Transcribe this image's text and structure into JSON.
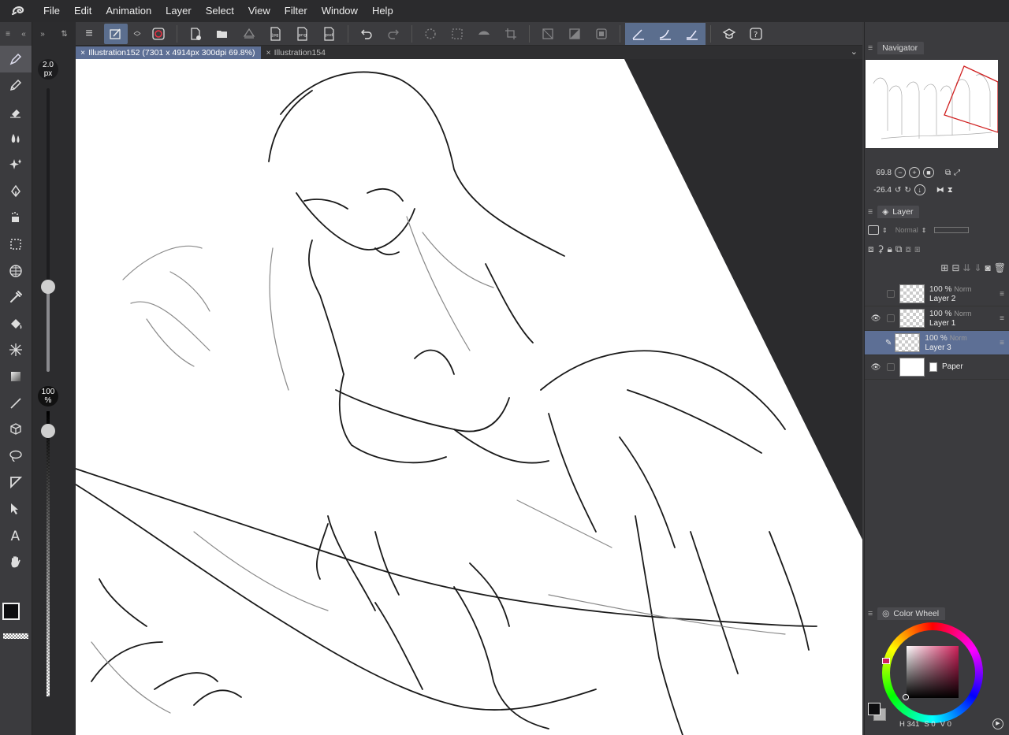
{
  "menu": {
    "items": [
      "File",
      "Edit",
      "Animation",
      "Layer",
      "Select",
      "View",
      "Filter",
      "Window",
      "Help"
    ]
  },
  "tabs": [
    {
      "label": "Illustration152 (7301 x 4914px 300dpi 69.8%)",
      "active": true
    },
    {
      "label": "Illustration154",
      "active": false
    }
  ],
  "toolbar": {
    "icons": [
      "menu-icon",
      "quick-access-icon",
      "toggle-icon",
      "record-icon",
      "new-canvas-icon",
      "open-icon",
      "save-icon",
      "export-jpg-icon",
      "export-png-icon",
      "export-psd-icon",
      "undo-icon",
      "redo-icon",
      "loading-icon",
      "selection-icon",
      "fill-icon",
      "crop-icon",
      "clear-icon",
      "transform-icon",
      "fit-icon",
      "stabilizer-1-icon",
      "stabilizer-2-icon",
      "stabilizer-3-icon",
      "academy-icon",
      "help-icon"
    ],
    "export_jpg": "jpg",
    "export_png": "png",
    "export_psd": "psd"
  },
  "brush": {
    "size_value": "2.0",
    "size_unit": "px",
    "size_level": 0.3,
    "opacity_value": "100",
    "opacity_unit": "%",
    "opacity_level": 1.0
  },
  "tools": [
    "pen",
    "pencil",
    "eraser",
    "blend",
    "decoration",
    "vector",
    "airbrush",
    "selection",
    "grid",
    "eyedropper",
    "fill",
    "effect",
    "gradient",
    "line",
    "3d",
    "lasso",
    "warp",
    "move",
    "text",
    "hand"
  ],
  "navigator": {
    "title": "Navigator",
    "zoom": "69.8",
    "rotation": "-26.4"
  },
  "layer_panel": {
    "title": "Layer",
    "blend_mode": "Normal",
    "layers": [
      {
        "opacity": "100 %",
        "mode": "Norm",
        "name": "Layer 2",
        "visible": false,
        "selected": false,
        "type": "raster"
      },
      {
        "opacity": "100 %",
        "mode": "Norm",
        "name": "Layer 1",
        "visible": true,
        "selected": false,
        "type": "raster"
      },
      {
        "opacity": "100 %",
        "mode": "Norm",
        "name": "Layer 3",
        "visible": false,
        "selected": true,
        "type": "raster"
      },
      {
        "opacity": "",
        "mode": "",
        "name": "Paper",
        "visible": true,
        "selected": false,
        "type": "paper"
      }
    ]
  },
  "color_wheel": {
    "title": "Color Wheel",
    "hue": "341",
    "saturation": "0",
    "value": "0",
    "h_label": "H",
    "s_label": "S",
    "v_label": "V",
    "main_color": "#0d0d0f",
    "sub_color": "#b0b0b0"
  },
  "colors": {
    "accent": "#5d6f95",
    "canvas_bg": "#2b2b2d",
    "panel_bg": "#3b3b3e"
  }
}
